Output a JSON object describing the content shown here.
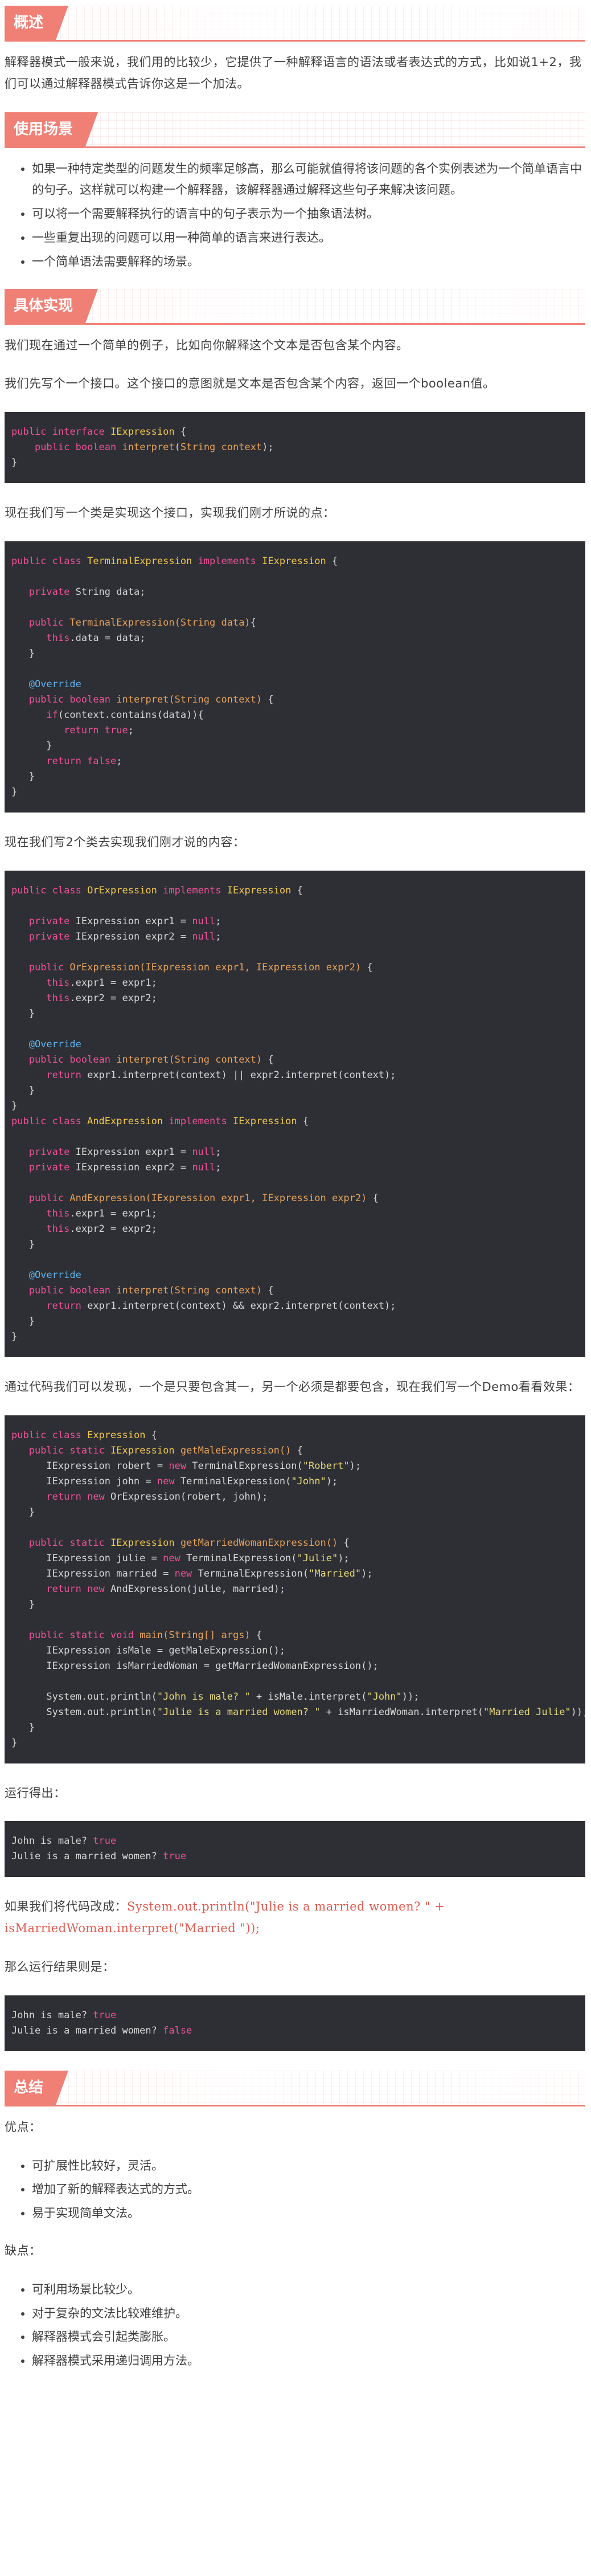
{
  "sections": {
    "overview": {
      "title": "概述"
    },
    "usage": {
      "title": "使用场景"
    },
    "impl": {
      "title": "具体实现"
    },
    "summary": {
      "title": "总结"
    }
  },
  "overview": {
    "text": "解释器模式一般来说，我们用的比较少，它提供了一种解释语言的语法或者表达式的方式，比如说1+2，我们可以通过解释器模式告诉你这是一个加法。"
  },
  "usage": {
    "items": [
      "如果一种特定类型的问题发生的频率足够高，那么可能就值得将该问题的各个实例表述为一个简单语言中的句子。这样就可以构建一个解释器，该解释器通过解释这些句子来解决该问题。",
      "可以将一个需要解释执行的语言中的句子表示为一个抽象语法树。",
      "一些重复出现的问题可以用一种简单的语言来进行表达。",
      "一个简单语法需要解释的场景。"
    ]
  },
  "impl": {
    "p1": "我们现在通过一个简单的例子，比如向你解释这个文本是否包含某个内容。",
    "p2": "我们先写个一个接口。这个接口的意图就是文本是否包含某个内容，返回一个boolean值。",
    "p3": "现在我们写一个类是实现这个接口，实现我们刚才所说的点：",
    "p4": "现在我们写2个类去实现我们刚才说的内容：",
    "p5": "通过代码我们可以发现，一个是只要包含其一，另一个必须是都要包含，现在我们写一个Demo看看效果：",
    "p6": "运行得出：",
    "p7_prefix": "如果我们将代码改成：",
    "p7_code": "System.out.println(\"Julie is a married women? \" + isMarriedWoman.interpret(\"Married \"));",
    "p8": "那么运行结果则是：",
    "output1": {
      "line1_label": "John is male? ",
      "line1_value": "true",
      "line2_label": "Julie is a married women? ",
      "line2_value": "true"
    },
    "output2": {
      "line1_label": "John is male? ",
      "line1_value": "true",
      "line2_label": "Julie is a married women? ",
      "line2_value": "false"
    }
  },
  "summary": {
    "pros_label": "优点：",
    "pros": [
      "可扩展性比较好，灵活。",
      "增加了新的解释表达式的方式。",
      "易于实现简单文法。"
    ],
    "cons_label": "缺点：",
    "cons": [
      "可利用场景比较少。",
      "对于复杂的文法比较难维护。",
      "解释器模式会引起类膨胀。",
      "解释器模式采用递归调用方法。"
    ]
  },
  "colors": {
    "accent": "#f08076",
    "code_bg": "#2d2f34"
  }
}
